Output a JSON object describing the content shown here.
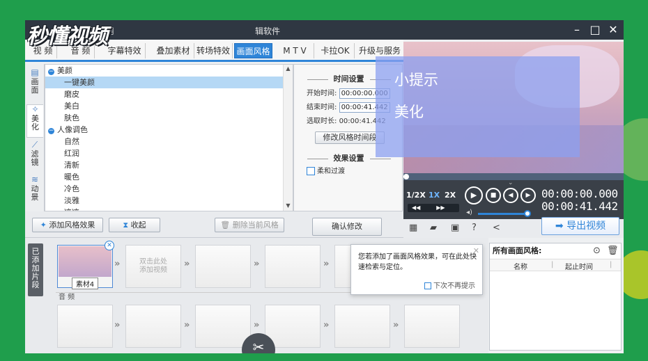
{
  "watermark": "秒懂视频",
  "app": {
    "title_left": "易易用",
    "title_right": "辑软件"
  },
  "window": {
    "minimize": "–",
    "maximize": "□",
    "close": "✕"
  },
  "tabs": [
    {
      "label": "视",
      "extra": "频"
    },
    {
      "label": "音",
      "extra": "频"
    },
    {
      "label": "字幕特效"
    },
    {
      "label": "叠加素材"
    },
    {
      "label": "转场特效"
    },
    {
      "label": "画面风格",
      "active": true
    },
    {
      "label": "M T V"
    },
    {
      "label": "卡拉OK"
    },
    {
      "label": "升级与服务"
    }
  ],
  "vtabs": [
    {
      "label": "画面",
      "icon": "image-icon"
    },
    {
      "label": "美化",
      "icon": "magic-wand-icon",
      "active": true
    },
    {
      "label": "滤镜",
      "icon": "filter-icon"
    },
    {
      "label": "动景",
      "icon": "wave-icon"
    }
  ],
  "style_list": [
    {
      "label": "美颜",
      "group": true
    },
    {
      "label": "一键美颜",
      "selected": true
    },
    {
      "label": "磨皮"
    },
    {
      "label": "美白"
    },
    {
      "label": "肤色"
    },
    {
      "label": "人像调色",
      "group": true
    },
    {
      "label": "自然"
    },
    {
      "label": "红润"
    },
    {
      "label": "清新"
    },
    {
      "label": "暖色"
    },
    {
      "label": "冷色"
    },
    {
      "label": "淡雅"
    },
    {
      "label": "凉凉"
    }
  ],
  "settings": {
    "time_section": "时间设置",
    "start_label": "开始时间:",
    "start_value": "00:00:00.000",
    "end_label": "结束时间:",
    "end_value": "00:00:41.442",
    "dur_label": "选取时长:",
    "dur_value": "00:00:41.442",
    "modify_time_btn": "修改风格时间段",
    "effect_section": "效果设置",
    "soft_transition": "柔和过渡"
  },
  "bottom_buttons": {
    "add_effect": "添加风格效果",
    "collapse": "收起",
    "delete_current": "删除当前风格",
    "confirm": "确认修改"
  },
  "hint": {
    "title": "小提示",
    "body": "美化"
  },
  "player": {
    "speed_half": "1/2X",
    "speed_1x": "1X",
    "speed_2x": "2X",
    "time_current": "00:00:00.000",
    "time_total": "00:00:41.442",
    "export": "导出视频"
  },
  "timeline": {
    "seg_tab": "已添加片段",
    "clip1_name": "素材4",
    "add_video_line1": "双击此处",
    "add_video_line2": "添加视频",
    "audio_label": "音 频"
  },
  "popup": {
    "message": "您若添加了画面风格效果，可在此处快速检索与定位。",
    "dont_show": "下次不再提示"
  },
  "style_panel": {
    "header": "所有画面风格:",
    "col_name": "名称",
    "col_start": "起止时间"
  }
}
